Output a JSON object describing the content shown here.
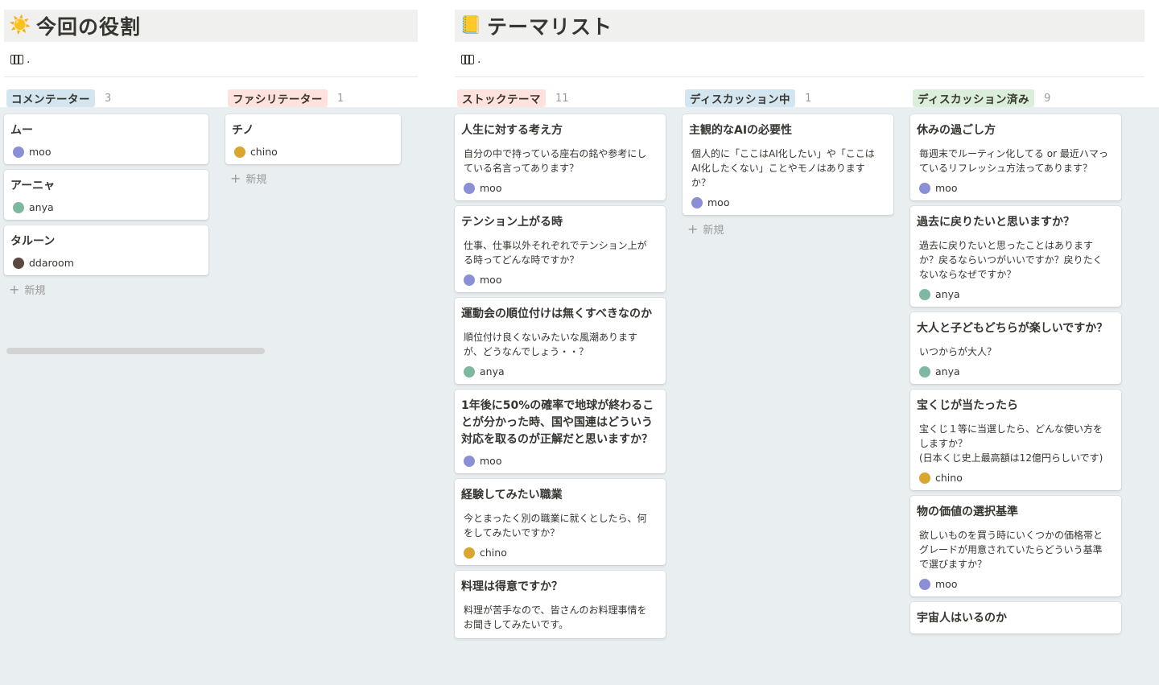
{
  "colors": {
    "commentator_tag_bg": "#d3e5ef",
    "facilitator_tag_bg": "#ffe2dd",
    "stock_tag_bg": "#ffe2dd",
    "discussing_tag_bg": "#d3e5ef",
    "discussed_tag_bg": "#dbeddb",
    "page_bg": "#e9eef1"
  },
  "avatars": {
    "moo": {
      "icon": "moo-avatar-icon",
      "color": "#8b8fd6"
    },
    "anya": {
      "icon": "anya-avatar-icon",
      "color": "#7fb8a1"
    },
    "chino": {
      "icon": "chino-avatar-icon",
      "color": "#d9a630"
    },
    "ddaroom": {
      "icon": "ddaroom-avatar-icon",
      "color": "#5a4a3e"
    }
  },
  "roles_board": {
    "icon": "☀️",
    "title": "今回の役割",
    "view_label": ".",
    "columns": [
      {
        "name": "コメンテーター",
        "count": "3",
        "cards": [
          {
            "title": "ムー",
            "person": "moo"
          },
          {
            "title": "アーニャ",
            "person": "anya"
          },
          {
            "title": "タルーン",
            "person": "ddaroom"
          }
        ],
        "new_label": "新規"
      },
      {
        "name": "ファシリテーター",
        "count": "1",
        "cards": [
          {
            "title": "チノ",
            "person": "chino"
          }
        ],
        "new_label": "新規"
      }
    ]
  },
  "theme_board": {
    "icon": "📒",
    "title": "テーマリスト",
    "view_label": ".",
    "columns": [
      {
        "name": "ストックテーマ",
        "count": "11",
        "cards": [
          {
            "title": "人生に対する考え方",
            "desc": "自分の中で持っている座右の銘や参考にし\nている名言ってあります？",
            "person": "moo"
          },
          {
            "title": "テンション上がる時",
            "desc": "仕事、仕事以外それぞれでテンション上が\nる時ってどんな時ですか？",
            "person": "moo"
          },
          {
            "title": "運動会の順位付けは無くすべきなのか",
            "desc": "順位付け良くないみたいな風潮あります\nが、どうなんでしょう・・？",
            "person": "anya"
          },
          {
            "title": "1年後に50%の確率で地球が終わるこ\nとが分かった時、国や国連はどういう\n対応を取るのが正解だと思いますか？",
            "desc": "",
            "person": "moo"
          },
          {
            "title": "経験してみたい職業",
            "desc": "今とまったく別の職業に就くとしたら、何\nをしてみたいですか？",
            "person": "chino"
          },
          {
            "title": "料理は得意ですか？",
            "desc": "料理が苦手なので、皆さんのお料理事情を\nお聞きしてみたいです。",
            "person": ""
          }
        ]
      },
      {
        "name": "ディスカッション中",
        "count": "1",
        "cards": [
          {
            "title": "主観的なAIの必要性",
            "desc": "個人的に「ここはAI化したい」や「ここは\nAI化したくない」ことやモノはあります\nか？",
            "person": "moo"
          }
        ],
        "new_label": "新規"
      },
      {
        "name": "ディスカッション済み",
        "count": "9",
        "cards": [
          {
            "title": "休みの過ごし方",
            "desc": "毎週末でルーティン化してる or 最近ハマっ\nているリフレッシュ方法ってあります？",
            "person": "moo"
          },
          {
            "title": "過去に戻りたいと思いますか？",
            "desc": "過去に戻りたいと思ったことはあります\nか？戻るならいつがいいですか？戻りたく\nないならなぜですか？",
            "person": "anya"
          },
          {
            "title": "大人と子どもどちらが楽しいですか？",
            "desc": "いつからが大人？",
            "person": "anya"
          },
          {
            "title": "宝くじが当たったら",
            "desc": "宝くじ１等に当選したら、どんな使い方を\nしますか？\n(日本くじ史上最高額は12億円らしいです)",
            "person": "chino"
          },
          {
            "title": "物の価値の選択基準",
            "desc": "欲しいものを買う時にいくつかの価格帯と\nグレードが用意されていたらどういう基準\nで選びますか？",
            "person": "moo"
          },
          {
            "title": "宇宙人はいるのか",
            "desc": "",
            "person": ""
          }
        ]
      }
    ]
  }
}
